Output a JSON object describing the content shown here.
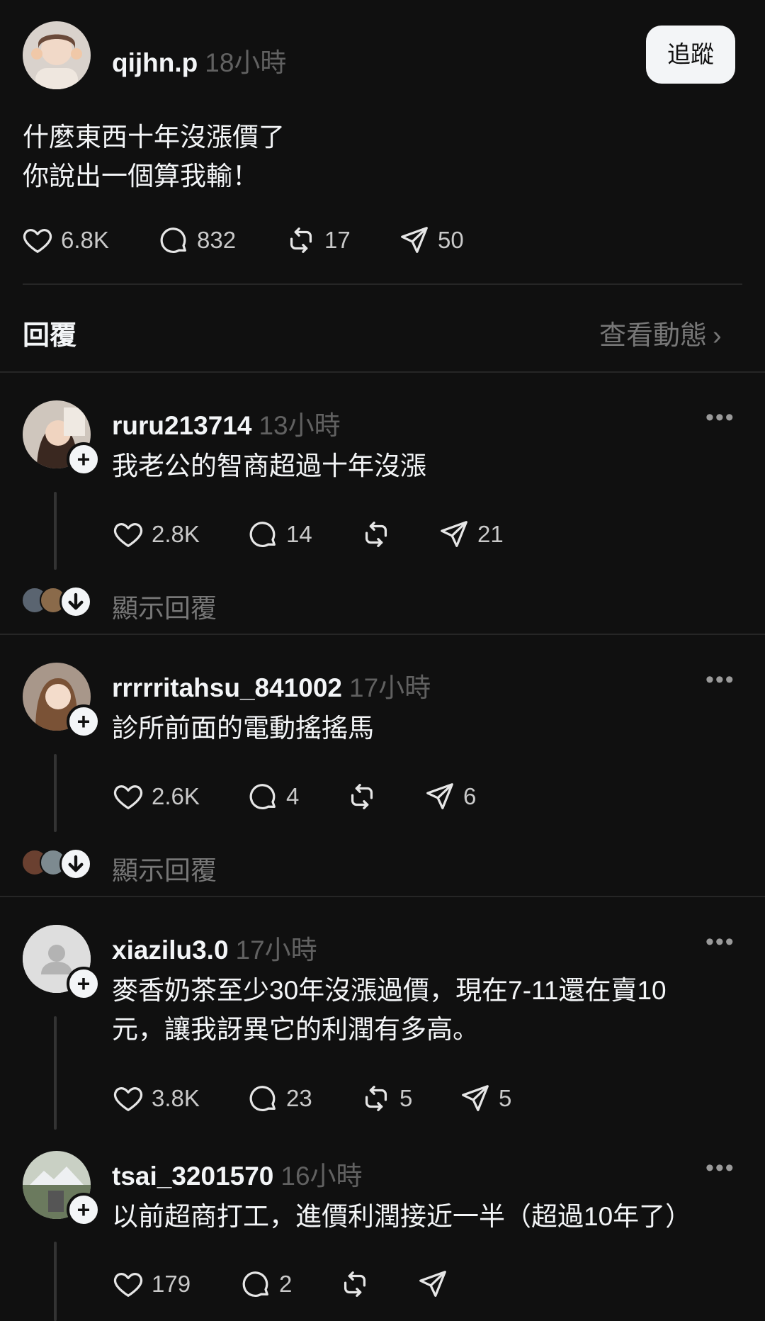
{
  "post": {
    "username": "qijhn.p",
    "time": "18小時",
    "follow_label": "追蹤",
    "text_line1": "什麼東西十年沒漲價了",
    "text_line2": "你說出一個算我輸！",
    "likes": "6.8K",
    "comments": "832",
    "reposts": "17",
    "shares": "50"
  },
  "replies_header": {
    "title": "回覆",
    "activity_link": "查看動態"
  },
  "replies": [
    {
      "username": "ruru213714",
      "time": "13小時",
      "text": "我老公的智商超過十年沒漲",
      "likes": "2.8K",
      "comments": "14",
      "reposts": "",
      "shares": "21",
      "show_replies": "顯示回覆"
    },
    {
      "username": "rrrrritahsu_841002",
      "time": "17小時",
      "text": "診所前面的電動搖搖馬",
      "likes": "2.6K",
      "comments": "4",
      "reposts": "",
      "shares": "6",
      "show_replies": "顯示回覆"
    },
    {
      "username": "xiazilu3.0",
      "time": "17小時",
      "text_line1": "麥香奶茶至少30年沒漲過價，現在7-11還在賣10",
      "text_line2": "元，讓我訝異它的利潤有多高。",
      "likes": "3.8K",
      "comments": "23",
      "reposts": "5",
      "shares": "5"
    },
    {
      "username": "tsai_3201570",
      "time": "16小時",
      "text": "以前超商打工，進價利潤接近一半（超過10年了）",
      "likes": "179",
      "comments": "2",
      "reposts": "",
      "shares": ""
    }
  ],
  "icons": {
    "like": "heart-icon",
    "comment": "comment-bubble-icon",
    "repost": "repost-icon",
    "share": "send-icon",
    "more": "more-dots-icon",
    "chevron": "chevron-right-icon",
    "follow_plus": "plus-icon",
    "expand": "chevron-down-icon"
  },
  "colors": {
    "background": "#101010",
    "text": "#f3f5f7",
    "muted": "#616161",
    "divider": "#262626"
  }
}
